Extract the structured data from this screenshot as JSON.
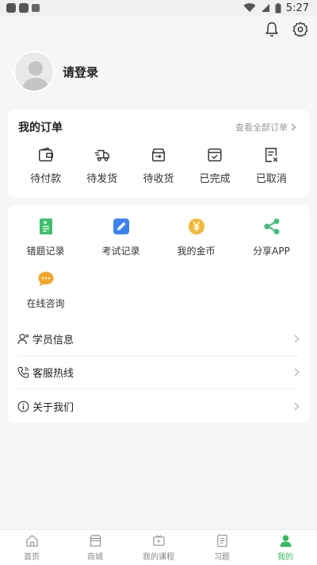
{
  "status_bar": {
    "time": "5:27"
  },
  "profile": {
    "login_text": "请登录"
  },
  "orders": {
    "title": "我的订单",
    "view_all": "查看全部订单",
    "items": [
      {
        "label": "待付款",
        "icon": "wallet-icon"
      },
      {
        "label": "待发货",
        "icon": "delivery-truck-icon"
      },
      {
        "label": "待收货",
        "icon": "receive-box-icon"
      },
      {
        "label": "已完成",
        "icon": "completed-check-icon"
      },
      {
        "label": "已取消",
        "icon": "cancelled-icon"
      }
    ]
  },
  "services": {
    "grid": [
      {
        "label": "错题记录",
        "icon": "wrong-question-icon",
        "color": "#3cc06a"
      },
      {
        "label": "考试记录",
        "icon": "exam-record-icon",
        "color": "#3b82f6"
      },
      {
        "label": "我的金币",
        "icon": "gold-coin-icon",
        "color": "#f5b731"
      },
      {
        "label": "分享APP",
        "icon": "share-icon",
        "color": "#3cc07a"
      },
      {
        "label": "在线咨询",
        "icon": "chat-icon",
        "color": "#f5a623"
      }
    ],
    "list": [
      {
        "label": "学员信息",
        "icon": "student-info-icon"
      },
      {
        "label": "客服热线",
        "icon": "phone-icon"
      },
      {
        "label": "关于我们",
        "icon": "info-icon"
      }
    ]
  },
  "tabbar": {
    "items": [
      {
        "label": "首页",
        "icon": "home-icon",
        "active": false
      },
      {
        "label": "商城",
        "icon": "store-icon",
        "active": false
      },
      {
        "label": "我的课程",
        "icon": "course-icon",
        "active": false
      },
      {
        "label": "习题",
        "icon": "exercise-icon",
        "active": false
      },
      {
        "label": "我的",
        "icon": "profile-icon",
        "active": true
      }
    ]
  },
  "colors": {
    "accent": "#2fbd5a",
    "background": "#f5f6f8"
  }
}
